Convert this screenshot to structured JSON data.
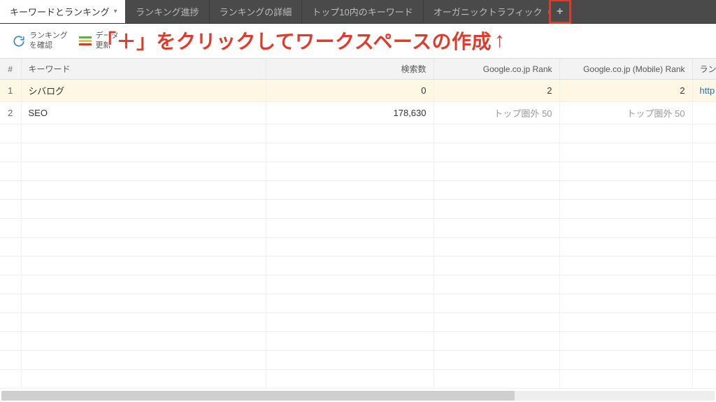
{
  "tabs": [
    {
      "label": "キーワードとランキング",
      "active": true,
      "hasDropdown": true
    },
    {
      "label": "ランキング進捗"
    },
    {
      "label": "ランキングの詳細"
    },
    {
      "label": "トップ10内のキーワード"
    },
    {
      "label": "オーガニックトラフィック（Google A..."
    }
  ],
  "addTabGlyph": "+",
  "toolbar": {
    "checkRanking": {
      "line1": "ランキング",
      "line2": "を確認"
    },
    "dataUpdate": {
      "line1": "データ",
      "line2": "更新"
    }
  },
  "annotation": {
    "text": "「＋」をクリックしてワークスペースの作成",
    "arrow": "↑"
  },
  "columns": {
    "idx": "#",
    "keyword": "キーワード",
    "searchVolume": "検索数",
    "rank1": "Google.co.jp Rank",
    "rank2": "Google.co.jp (Mobile) Rank",
    "last": "ラン"
  },
  "rows": [
    {
      "idx": "1",
      "keyword": "シバログ",
      "searchVolume": "0",
      "rank1": "2",
      "rank2": "2",
      "last": "http",
      "highlight": true,
      "lastIsLink": true
    },
    {
      "idx": "2",
      "keyword": "SEO",
      "searchVolume": "178,630",
      "rank1": "トップ圏外 50",
      "rank2": "トップ圏外 50",
      "last": "",
      "muted": true
    }
  ]
}
